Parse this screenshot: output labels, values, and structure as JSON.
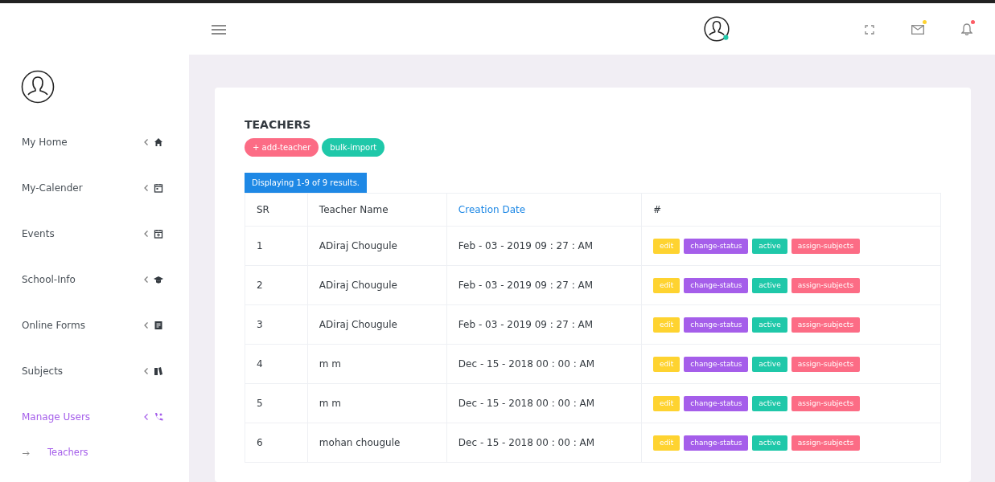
{
  "header": {
    "icons": [
      {
        "kind": "fullscreen"
      },
      {
        "kind": "mail",
        "color": "#fed330"
      },
      {
        "kind": "bell",
        "color": "#fc5c65"
      }
    ]
  },
  "sidebar": {
    "items": [
      {
        "label": "My Home",
        "selected": false
      },
      {
        "label": "My-Calender",
        "selected": false
      },
      {
        "label": "Events",
        "selected": false
      },
      {
        "label": "School-Info",
        "selected": false
      },
      {
        "label": "Online Forms",
        "selected": false
      },
      {
        "label": "Subjects",
        "selected": false
      },
      {
        "label": "Manage Users",
        "selected": true,
        "children": [
          {
            "label": "Teachers",
            "selected": true
          }
        ]
      }
    ]
  },
  "page": {
    "title": "TEACHERS",
    "buttons": [
      {
        "label": "+ add-teacher",
        "color": "#fc6c85"
      },
      {
        "label": "bulk-import",
        "color": "#1fc8a9"
      }
    ],
    "summary": "Displaying 1-9 of 9 results."
  },
  "table": {
    "columns": [
      {
        "label": "SR",
        "kind": "text"
      },
      {
        "label": "Teacher Name",
        "kind": "text"
      },
      {
        "label": "Creation Date",
        "kind": "link"
      },
      {
        "label": "#",
        "kind": "text"
      }
    ],
    "rows": [
      {
        "sr": "1",
        "name": "ADiraj Chougule",
        "date": "Feb - 03 - 2019 09 : 27 : AM",
        "actions": [
          {
            "label": "edit",
            "color": "#fed330"
          },
          {
            "label": "change-status",
            "color": "#a55eea"
          },
          {
            "label": "active",
            "color": "#1fc8a9"
          },
          {
            "label": "assign-subjects",
            "color": "#fc6c85"
          }
        ]
      },
      {
        "sr": "2",
        "name": "ADiraj Chougule",
        "date": "Feb - 03 - 2019 09 : 27 : AM",
        "actions": [
          {
            "label": "edit",
            "color": "#fed330"
          },
          {
            "label": "change-status",
            "color": "#a55eea"
          },
          {
            "label": "active",
            "color": "#1fc8a9"
          },
          {
            "label": "assign-subjects",
            "color": "#fc6c85"
          }
        ]
      },
      {
        "sr": "3",
        "name": "ADiraj Chougule",
        "date": "Feb - 03 - 2019 09 : 27 : AM",
        "actions": [
          {
            "label": "edit",
            "color": "#fed330"
          },
          {
            "label": "change-status",
            "color": "#a55eea"
          },
          {
            "label": "active",
            "color": "#1fc8a9"
          },
          {
            "label": "assign-subjects",
            "color": "#fc6c85"
          }
        ]
      },
      {
        "sr": "4",
        "name": "m m",
        "date": "Dec - 15 - 2018 00 : 00 : AM",
        "actions": [
          {
            "label": "edit",
            "color": "#fed330"
          },
          {
            "label": "change-status",
            "color": "#a55eea"
          },
          {
            "label": "active",
            "color": "#1fc8a9"
          },
          {
            "label": "assign-subjects",
            "color": "#fc6c85"
          }
        ]
      },
      {
        "sr": "5",
        "name": "m m",
        "date": "Dec - 15 - 2018 00 : 00 : AM",
        "actions": [
          {
            "label": "edit",
            "color": "#fed330"
          },
          {
            "label": "change-status",
            "color": "#a55eea"
          },
          {
            "label": "active",
            "color": "#1fc8a9"
          },
          {
            "label": "assign-subjects",
            "color": "#fc6c85"
          }
        ]
      },
      {
        "sr": "6",
        "name": "mohan chougule",
        "date": "Dec - 15 - 2018 00 : 00 : AM",
        "actions": [
          {
            "label": "edit",
            "color": "#fed330"
          },
          {
            "label": "change-status",
            "color": "#a55eea"
          },
          {
            "label": "active",
            "color": "#1fc8a9"
          },
          {
            "label": "assign-subjects",
            "color": "#fc6c85"
          }
        ]
      }
    ]
  }
}
